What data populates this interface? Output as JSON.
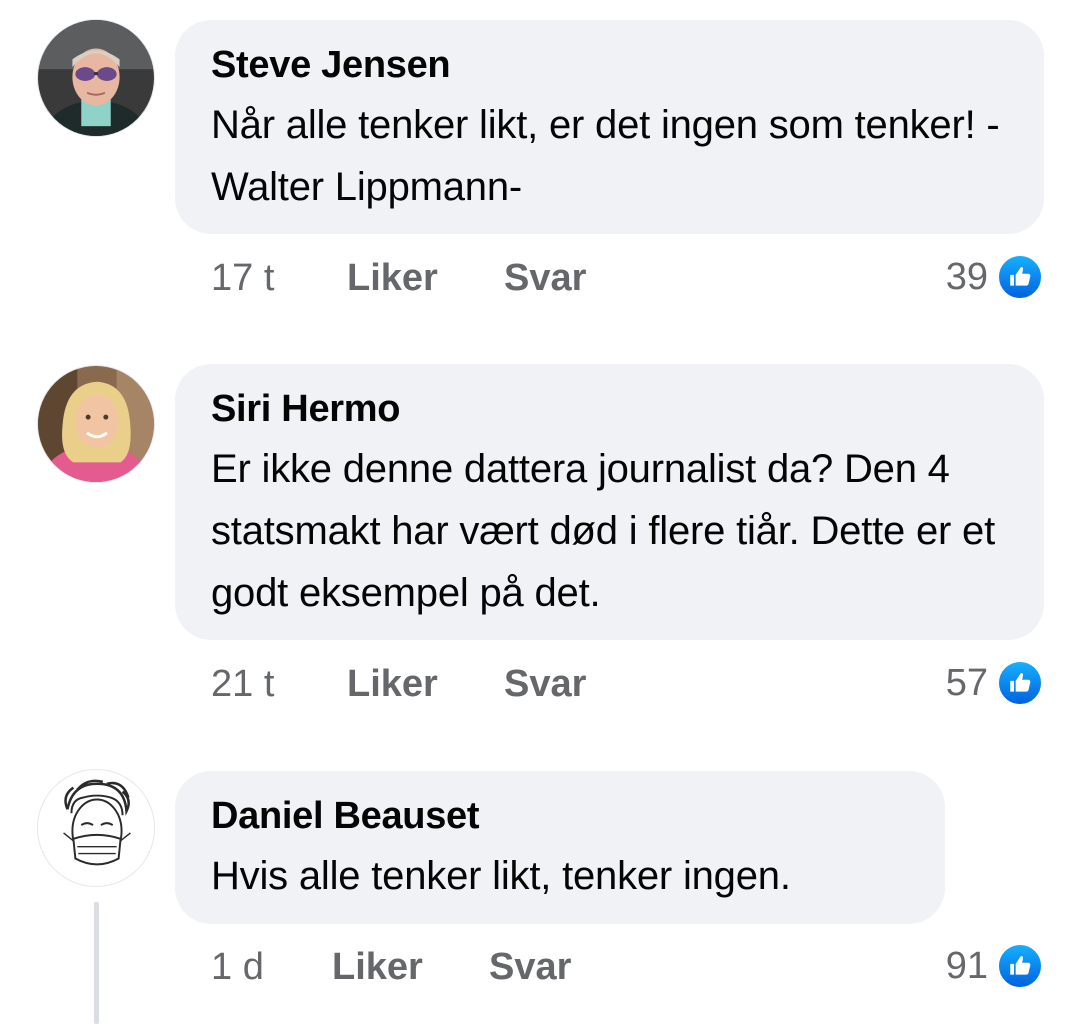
{
  "comments": [
    {
      "author": "Steve Jensen",
      "text": "Når alle tenker likt, er det ingen som tenker! -Walter Lippmann-",
      "time": "17 t",
      "like_label": "Liker",
      "reply_label": "Svar",
      "reaction_count": "39",
      "avatar_icon": "avatar-photo-man-sunglasses"
    },
    {
      "author": "Siri Hermo",
      "text": "Er ikke denne dattera journalist da? Den 4 statsmakt har vært død i flere tiår. Dette er et godt eksempel på det.",
      "time": "21 t",
      "like_label": "Liker",
      "reply_label": "Svar",
      "reaction_count": "57",
      "avatar_icon": "avatar-photo-woman-blonde"
    },
    {
      "author": "Daniel Beauset",
      "text": "Hvis alle tenker likt, tenker ingen.",
      "time": "1 d",
      "like_label": "Liker",
      "reply_label": "Svar",
      "reaction_count": "91",
      "avatar_icon": "avatar-sketch-masked-face"
    }
  ],
  "colors": {
    "bubble_bg": "#f0f2f5",
    "text": "#050505",
    "meta_text": "#65676b",
    "like_blue_top": "#18afff",
    "like_blue_bottom": "#0062df",
    "thread_line": "#dadde1"
  }
}
